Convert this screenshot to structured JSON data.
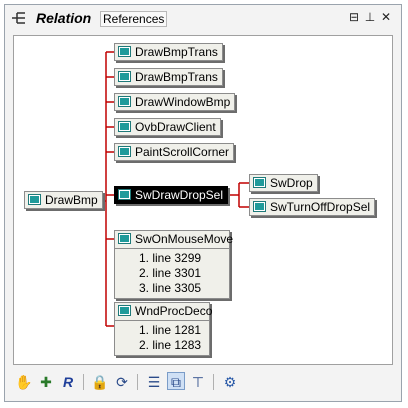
{
  "header": {
    "title": "Relation",
    "references_label": "References",
    "buttons": [
      {
        "name": "pin-button",
        "glyph": "⊟"
      },
      {
        "name": "dock-button",
        "glyph": "⊥"
      },
      {
        "name": "close-button",
        "glyph": "✕"
      }
    ]
  },
  "graph": {
    "root": "DrawBmp",
    "callers": [
      "DrawBmpTrans",
      "DrawBmpTrans",
      "DrawWindowBmp",
      "OvbDrawClient",
      "PaintScrollCorner"
    ],
    "selected": "SwDrawDropSel",
    "callees": [
      "SwDrop",
      "SwTurnOffDropSel"
    ],
    "groups": [
      {
        "name": "SwOnMouseMove",
        "lines": [
          "1. line 3299",
          "2. line 3301",
          "3. line 3305"
        ]
      },
      {
        "name": "WndProcDeco",
        "lines": [
          "1. line 1281",
          "2. line 1283"
        ]
      }
    ]
  },
  "colors": {
    "connector": "#c00000",
    "node_icon": "#1f9a9a",
    "selected_bg": "#000000"
  },
  "toolbar": {
    "buttons": [
      {
        "name": "hand-icon",
        "glyph": "✋"
      },
      {
        "name": "new-item-icon",
        "glyph": "✚"
      },
      {
        "name": "r-logo-icon",
        "glyph": "R"
      },
      {
        "name": "lock-icon",
        "glyph": "🔒"
      },
      {
        "name": "refresh-icon",
        "glyph": "⟳"
      },
      {
        "name": "list-view-icon",
        "glyph": "☰"
      },
      {
        "name": "graph-view-icon",
        "glyph": "⧉"
      },
      {
        "name": "tree-view-icon",
        "glyph": "⊤"
      },
      {
        "name": "settings-gear-icon",
        "glyph": "⚙"
      }
    ]
  }
}
